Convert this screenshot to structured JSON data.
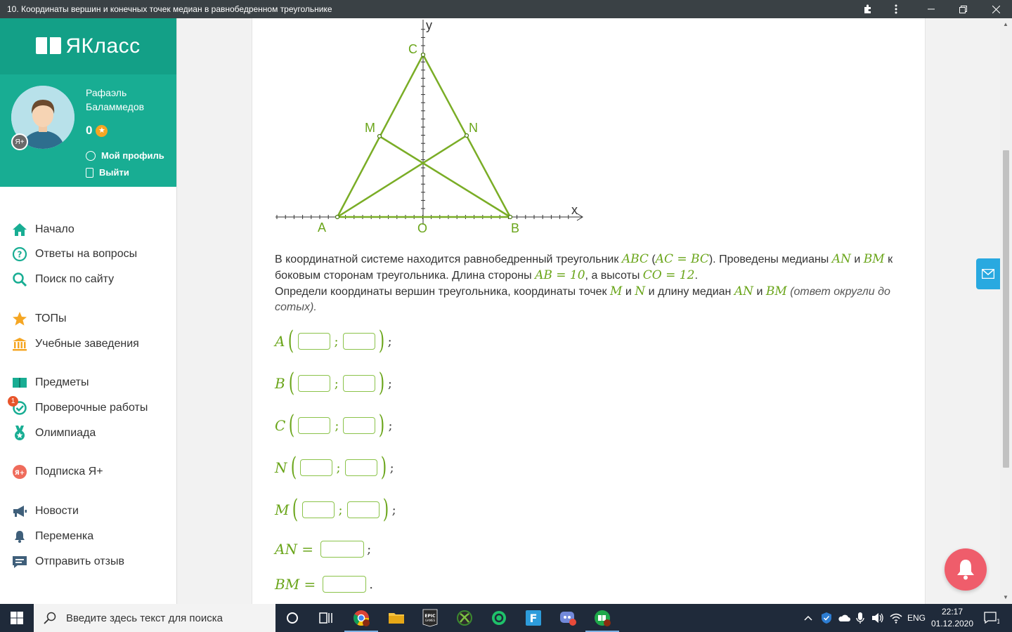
{
  "window": {
    "title": "10. Координаты вершин и конечных точек медиан в равнобедренном треугольнике"
  },
  "sidebar": {
    "brand": "ЯКласс",
    "profile": {
      "name_line1": "Рафаэль",
      "name_line2": "Баламмедов",
      "score": "0",
      "badge": "Я+",
      "my_profile": "Мой профиль",
      "logout": "Выйти"
    },
    "nav": [
      {
        "label": "Начало",
        "icon": "home-icon"
      },
      {
        "label": "Ответы на вопросы",
        "icon": "question-icon"
      },
      {
        "label": "Поиск по сайту",
        "icon": "search-icon"
      },
      {
        "label": "ТОПы",
        "icon": "star-icon"
      },
      {
        "label": "Учебные заведения",
        "icon": "institution-icon"
      },
      {
        "label": "Предметы",
        "icon": "subjects-icon"
      },
      {
        "label": "Проверочные работы",
        "icon": "check-works-icon",
        "badge": "1"
      },
      {
        "label": "Олимпиада",
        "icon": "medal-icon"
      },
      {
        "label": "Подписка Я+",
        "icon": "subscription-icon"
      },
      {
        "label": "Новости",
        "icon": "megaphone-icon"
      },
      {
        "label": "Переменка",
        "icon": "bell-icon"
      },
      {
        "label": "Отправить отзыв",
        "icon": "feedback-icon"
      }
    ]
  },
  "figure": {
    "labels": {
      "y": "y",
      "x": "x",
      "C": "C",
      "M": "M",
      "N": "N",
      "A": "A",
      "O": "O",
      "B": "B"
    }
  },
  "problem": {
    "p1": "В координатной системе находится равнобедренный треугольник",
    "abc": "ABC",
    "cond": "AC = BC",
    "p2": ". Проведены медианы",
    "an": "AN",
    "and1": "и",
    "bm": "BM",
    "p3": "к боковым сторонам треугольника. Длина стороны",
    "ab": "AB = 10",
    "p4": ", а высоты",
    "co": "CO = 12",
    "p5": "Определи координаты вершин треугольника, координаты точек",
    "m": "M",
    "and2": "и",
    "n": "N",
    "p6": "и длину медиан",
    "an2": "AN",
    "and3": "и",
    "bm2": "BM",
    "hint": "(ответ округли до сотых)."
  },
  "answers": [
    {
      "label": "A",
      "end": ";"
    },
    {
      "label": "B",
      "end": ";"
    },
    {
      "label": "C",
      "end": ";"
    },
    {
      "label": "N",
      "end": ";"
    },
    {
      "label": "M",
      "end": ";"
    }
  ],
  "lengths": [
    {
      "label": "AN =",
      "end": ";"
    },
    {
      "label": "BM =",
      "end": "."
    }
  ],
  "taskbar": {
    "search_placeholder": "Введите здесь текст для поиска",
    "lang": "ENG",
    "time": "22:17",
    "date": "01.12.2020",
    "notif_count": "1"
  },
  "colors": {
    "brand": "#13a087",
    "accent": "#6aa51a",
    "taskbar": "#1f2a3a"
  }
}
